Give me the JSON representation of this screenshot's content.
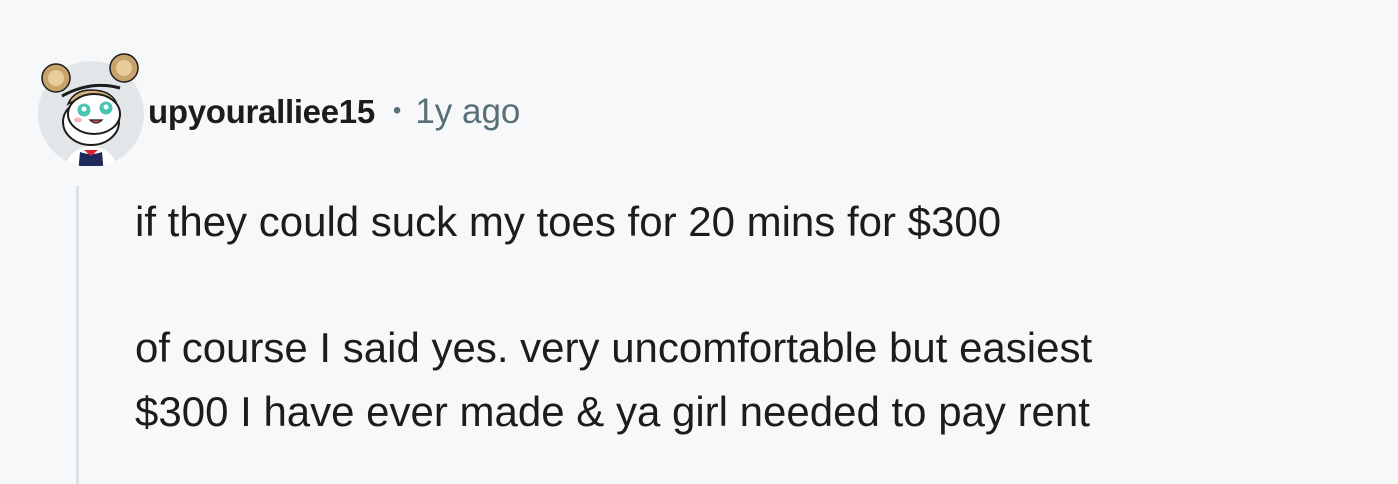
{
  "comment": {
    "author": {
      "username": "upyouralliee15",
      "avatar_icon": "snoo-avatar-icon"
    },
    "separator": "•",
    "timestamp": "1y ago",
    "body": {
      "paragraph_1": "if they could suck my toes for 20 mins for $300",
      "paragraph_2_line_1": "of course I said yes. very uncomfortable but easiest",
      "paragraph_2_line_2": "$300 I have ever made & ya girl needed to pay rent"
    }
  },
  "colors": {
    "background": "#f7f8fa",
    "text": "#1c1c1c",
    "meta_text": "#576f76",
    "thread_line": "#dbe1e5",
    "avatar_bg": "#e3e6e8"
  }
}
